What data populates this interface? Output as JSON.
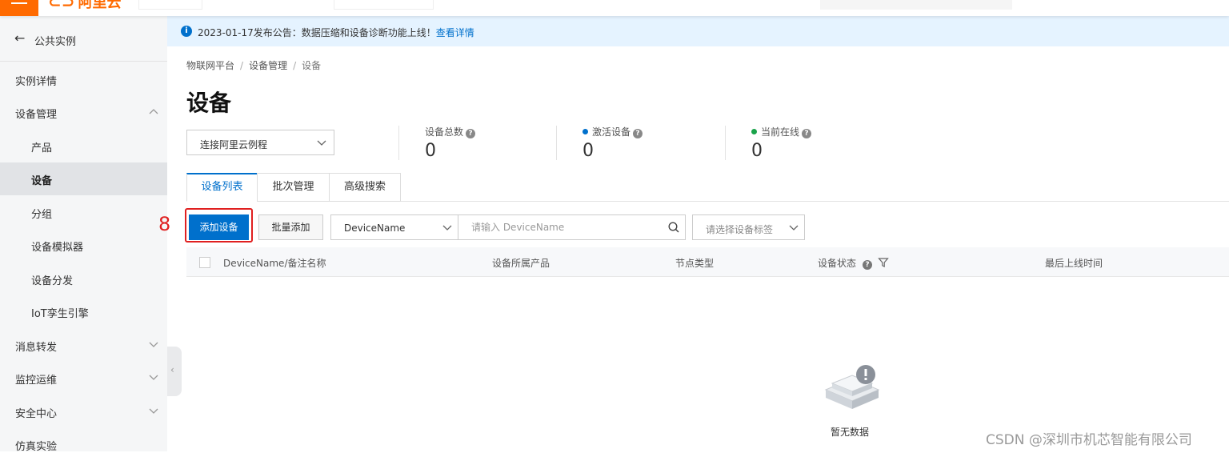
{
  "topbar": {
    "logo_text": "阿里云"
  },
  "sidebar": {
    "back_label": "公共实例",
    "items": [
      {
        "label": "实例详情"
      },
      {
        "label": "设备管理"
      },
      {
        "label": "产品"
      },
      {
        "label": "设备"
      },
      {
        "label": "分组"
      },
      {
        "label": "设备模拟器"
      },
      {
        "label": "设备分发"
      },
      {
        "label": "IoT孪生引擎"
      },
      {
        "label": "消息转发"
      },
      {
        "label": "监控运维"
      },
      {
        "label": "安全中心"
      },
      {
        "label": "仿真实验"
      }
    ]
  },
  "notice": {
    "text": "2023-01-17发布公告：数据压缩和设备诊断功能上线！",
    "link": "查看详情"
  },
  "breadcrumb": [
    "物联网平台",
    "设备管理",
    "设备"
  ],
  "page_title": "设备",
  "product_select": {
    "value": "连接阿里云例程"
  },
  "stats": [
    {
      "label": "设备总数",
      "value": "0"
    },
    {
      "label": "激活设备",
      "value": "0",
      "dot_color": "#0070cc"
    },
    {
      "label": "当前在线",
      "value": "0",
      "dot_color": "#1aa34a"
    }
  ],
  "tabs": [
    "设备列表",
    "批次管理",
    "高级搜索"
  ],
  "toolbar": {
    "step_marker": "8",
    "add_label": "添加设备",
    "batch_add_label": "批量添加",
    "field_select": "DeviceName",
    "search_placeholder": "请输入 DeviceName",
    "tag_select_placeholder": "请选择设备标签"
  },
  "table": {
    "columns": [
      "DeviceName/备注名称",
      "设备所属产品",
      "节点类型",
      "设备状态",
      "最后上线时间"
    ],
    "empty_text": "暂无数据"
  },
  "watermark": "CSDN @深圳市机芯智能有限公司",
  "colors": {
    "accent": "#0070cc",
    "brand": "#ff6a00",
    "annotation_red": "#e02020"
  }
}
